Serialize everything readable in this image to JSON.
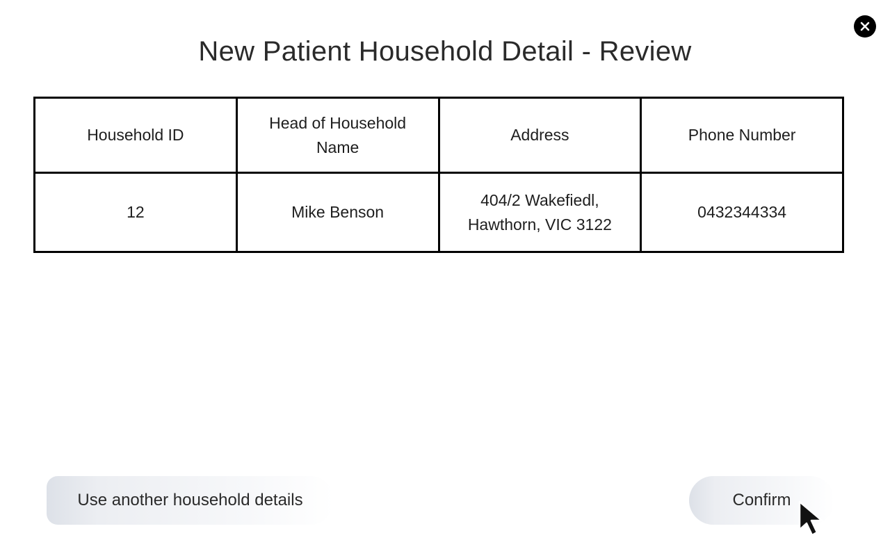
{
  "dialog": {
    "title": "New Patient Household Detail - Review",
    "close_icon": "close-icon"
  },
  "table": {
    "headers": [
      "Household ID",
      "Head of Household Name",
      "Address",
      "Phone Number"
    ],
    "rows": [
      {
        "household_id": "12",
        "head_name": "Mike Benson",
        "address": "404/2 Wakefiedl, Hawthorn, VIC 3122",
        "phone": "0432344334"
      }
    ]
  },
  "actions": {
    "secondary_label": "Use another household details",
    "primary_label": "Confirm"
  },
  "pointer": {
    "icon": "mouse-pointer-icon"
  },
  "colors": {
    "background": "#ffffff",
    "table_border": "#000000",
    "button_fill": "#eceef2",
    "close_button": "#000000"
  }
}
